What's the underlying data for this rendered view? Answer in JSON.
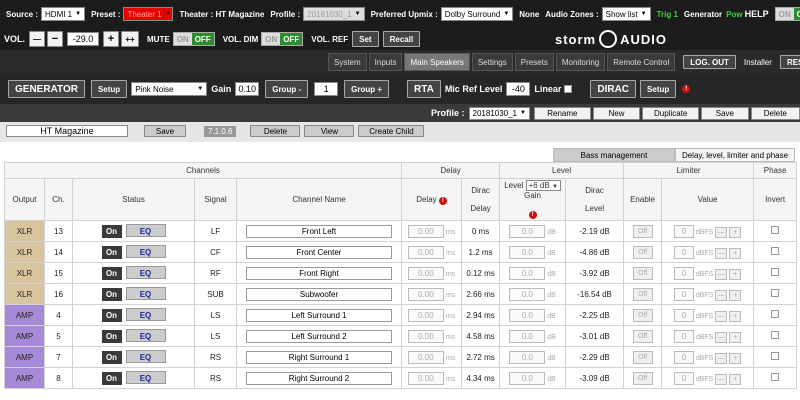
{
  "topbar": {
    "source_label": "Source :",
    "source_value": "HDMI 1",
    "preset_label": "Preset :",
    "preset_value": "Theater 1",
    "theater_label": "Theater : HT Magazine",
    "profile_label": "Profile :",
    "profile_value": "20181030_1",
    "upmix_label": "Preferred Upmix :",
    "upmix_value": "Dolby Surround",
    "none_label": "None",
    "zones_label": "Audio Zones :",
    "zones_value": "Show list",
    "trig_label": "Trig 1",
    "generator_label": "Generator",
    "pow_label": "Pow",
    "help_label": "HELP",
    "on_label": "ON",
    "off_label": "OFF"
  },
  "volbar": {
    "vol_label": "VOL.",
    "minus_minus": "—",
    "minus": "−",
    "vol_value": "-29.0",
    "plus": "+",
    "plus_plus": "++",
    "mute_label": "MUTE",
    "voldim_label": "VOL. DIM",
    "volref_label": "VOL. REF",
    "set_label": "Set",
    "recall_label": "Recall",
    "logo_left": "storm",
    "logo_right": "AUDIO"
  },
  "tabs": [
    "System",
    "Inputs",
    "Main Speakers",
    "Settings",
    "Presets",
    "Monitoring",
    "Remote Control"
  ],
  "active_tab": "Main Speakers",
  "actions": {
    "logout": "LOG. OUT",
    "installer": "Installer",
    "restart": "RESTART"
  },
  "generator_bar": {
    "generator": "GENERATOR",
    "setup": "Setup",
    "noise": "Pink Noise",
    "gain_label": "Gain",
    "gain_value": "0.10",
    "group_minus": "Group -",
    "group_value": "1",
    "group_plus": "Group +",
    "rta": "RTA",
    "mic_ref_label": "Mic Ref Level",
    "mic_ref_value": "-40",
    "linear_label": "Linear",
    "dirac": "DIRAC",
    "dirac_setup": "Setup"
  },
  "profile_bar": {
    "profile_label": "Profile :",
    "profile_value": "20181030_1",
    "rename": "Rename",
    "new": "New",
    "duplicate": "Duplicate",
    "save": "Save",
    "delete": "Delete"
  },
  "preset_bar": {
    "name": "HT Magazine",
    "save": "Save",
    "version": "7.1.0.6",
    "delete": "Delete",
    "view": "View",
    "create_child": "Create Child"
  },
  "subtabs": {
    "bass": "Bass management",
    "delay": "Delay, level, limiter and phase"
  },
  "table": {
    "groups": {
      "channels": "Channels",
      "delay": "Delay",
      "level": "Level",
      "limiter": "Limiter",
      "phase": "Phase"
    },
    "headers": {
      "output": "Output",
      "ch": "Ch.",
      "status": "Status",
      "signal": "Signal",
      "channel_name": "Channel Name",
      "delay": "Delay",
      "dirac_delay_1": "Dirac",
      "dirac_delay_2": "Delay",
      "level": "Level",
      "level_select": "+6 dB",
      "gain": "Gain",
      "dirac_level_1": "Dirac",
      "dirac_level_2": "Level",
      "enable": "Enable",
      "value": "Value",
      "invert": "Invert"
    },
    "cell_on": "On",
    "cell_eq": "EQ",
    "delay_placeholder": "0.00",
    "delay_unit": "ms",
    "level_placeholder": "0.0",
    "level_unit": "dB",
    "limiter_off": "Off",
    "limiter_value": "0",
    "limiter_unit": "dBFS",
    "limiter_minus": "—",
    "limiter_plus": "+",
    "rows": [
      {
        "output": "XLR",
        "ch": "13",
        "signal": "LF",
        "name": "Front Left",
        "dirac_delay": "0 ms",
        "dirac_level": "-2.19 dB"
      },
      {
        "output": "XLR",
        "ch": "14",
        "signal": "CF",
        "name": "Front Center",
        "dirac_delay": "1.2 ms",
        "dirac_level": "-4.86 dB"
      },
      {
        "output": "XLR",
        "ch": "15",
        "signal": "RF",
        "name": "Front Right",
        "dirac_delay": "0.12 ms",
        "dirac_level": "-3.92 dB"
      },
      {
        "output": "XLR",
        "ch": "16",
        "signal": "SUB",
        "name": "Subwoofer",
        "dirac_delay": "2.66 ms",
        "dirac_level": "-16.54 dB"
      },
      {
        "output": "AMP",
        "ch": "4",
        "signal": "LS",
        "name": "Left Surround 1",
        "dirac_delay": "2.94 ms",
        "dirac_level": "-2.25 dB"
      },
      {
        "output": "AMP",
        "ch": "5",
        "signal": "LS",
        "name": "Left Surround 2",
        "dirac_delay": "4.58 ms",
        "dirac_level": "-3.01 dB"
      },
      {
        "output": "AMP",
        "ch": "7",
        "signal": "RS",
        "name": "Right Surround 1",
        "dirac_delay": "2.72 ms",
        "dirac_level": "-2.29 dB"
      },
      {
        "output": "AMP",
        "ch": "8",
        "signal": "RS",
        "name": "Right Surround 2",
        "dirac_delay": "4.34 ms",
        "dirac_level": "-3.09 dB"
      }
    ]
  },
  "colors": {
    "xlr": "#d8c59e",
    "amp": "#a68ad8",
    "active_green": "#2e8b2e",
    "preset_red": "#e60000"
  }
}
